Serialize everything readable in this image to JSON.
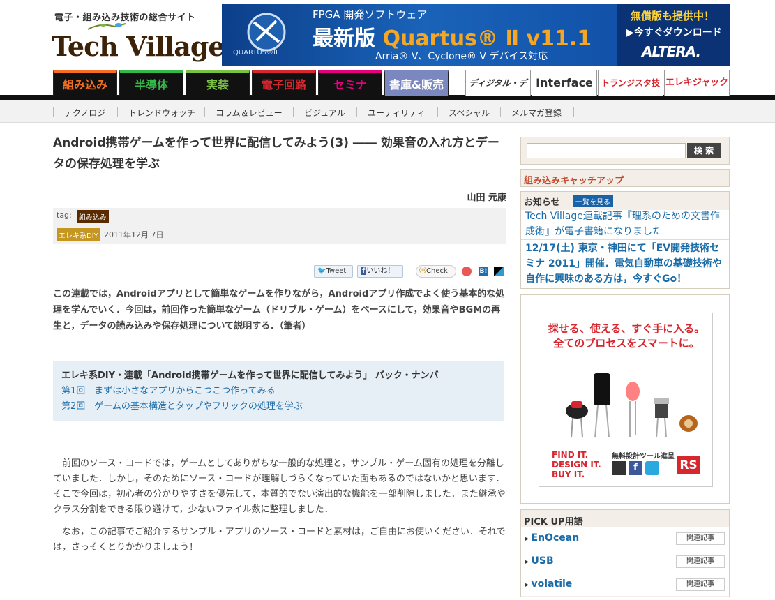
{
  "site": {
    "tagline": "電子・組み込み技術の総合サイト",
    "logo_text": "Tech Village"
  },
  "banner": {
    "sub": "FPGA 開発ソフトウェア",
    "main_prefix": "最新版 ",
    "main_product": "Quartus® Ⅱ v11.1",
    "devices": "Arria® Ⅴ、Cyclone® Ⅴ デバイス対応",
    "logo_label": "QUARTUS®II",
    "free": "無償版も提供中！",
    "download": "▶今すぐダウンロード",
    "brand": "ALTERA."
  },
  "nav": {
    "tabs": [
      "組み込み",
      "半導体",
      "実装",
      "電子回路",
      "セミナ",
      "書庫&販売"
    ],
    "magazines": [
      "ディジタル・デザイン",
      "Interface",
      "トランジスタ技術",
      "エレキジャック"
    ]
  },
  "subnav": [
    "テクノロジ",
    "トレンドウォッチ",
    "コラム＆レビュー",
    "ビジュアル",
    "ユーティリティ",
    "スペシャル",
    "メルマガ登録"
  ],
  "article": {
    "title": "Android携帯ゲームを作って世界に配信してみよう(3) ―― 効果音の入れ方とデータの保存処理を学ぶ",
    "author": "山田 元康",
    "tag_label": "tag:",
    "tag": "組み込み",
    "category": "エレキ系DIY",
    "date": "2011年12月 7日",
    "social": {
      "tweet": "Tweet",
      "like": "いいね！",
      "check": "Check"
    },
    "intro": "この連載では，Androidアプリとして簡単なゲームを作りながら，Androidアプリ作成でよく使う基本的な処理を学んでいく．今回は，前回作った簡単なゲーム（ドリブル・ゲーム）をベースにして，効果音やBGMの再生と，データの読み込みや保存処理について説明する．（筆者）",
    "backnum_title": "エレキ系DIY・連載「Android携帯ゲームを作って世界に配信してみよう」 バック・ナンバ",
    "backnum_links": [
      "第1回　まずは小さなアプリからこつこつ作ってみる",
      "第2回　ゲームの基本構造とタップやフリックの処理を学ぶ"
    ],
    "body1": "前回のソース・コードでは，ゲームとしてありがちな一般的な処理と，サンプル・ゲーム固有の処理を分離していました．しかし，そのためにソース・コードが理解しづらくなっていた面もあるのではないかと思います．そこで今回は，初心者の分かりやすさを優先して，本質的でない演出的な機能を一部削除しました．また継承やクラス分割をできる限り避けて，少ないファイル数に整理しました．",
    "body2": "なお，この記事でご紹介するサンプル・アプリのソース・コードと素材は，ご自由にお使いください．それでは，さっそくとりかかりましょう！"
  },
  "sidebar": {
    "search_button": "検 索",
    "catchup": "組み込みキャッチアップ",
    "notice_title": "お知らせ",
    "notice_button": "一覧を見る",
    "notices": [
      "Tech Village連載記事『理系のための文書作成術』が電子書籍になりました",
      "12/17(土) 東京・神田にて「EV開発技術セミナ 2011」開催．電気自動車の基礎技術や自作に興味のある方は，今すぐGo！"
    ],
    "ad": {
      "line1": "探せる、使える、すぐ手に入る。",
      "line2": "全てのプロセスをスマートに。",
      "find": "FIND IT.",
      "design": "DESIGN IT.",
      "buy": "BUY IT.",
      "free": "無料設計ツール進呈",
      "brand": "RS"
    },
    "pickup_title": "PICK UP用語",
    "pickup": [
      {
        "label": "EnOcean",
        "rel": "関連記事"
      },
      {
        "label": "USB",
        "rel": "関連記事"
      },
      {
        "label": "volatile",
        "rel": "関連記事"
      }
    ]
  }
}
